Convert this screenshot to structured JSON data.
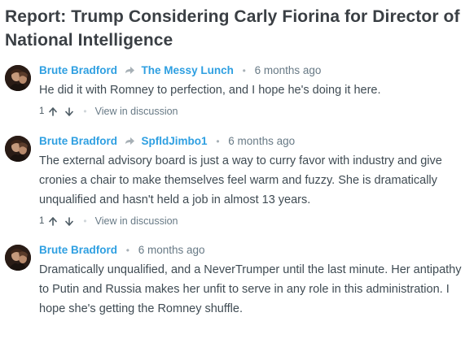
{
  "headline": "Report: Trump Considering Carly Fiorina for Director of National Intelligence",
  "colors": {
    "link": "#2e9fe1",
    "text": "#3f4b53",
    "muted": "#687a86",
    "headline": "#3a3f44"
  },
  "icons": {
    "reply_arrow": "reply-arrow-icon",
    "upvote": "upvote-arrow-icon",
    "downvote": "downvote-arrow-icon"
  },
  "comments": [
    {
      "author": "Brute Bradford",
      "reply_to": "The Messy Lunch",
      "time": "6 months ago",
      "body": "He did it with Romney to perfection, and I hope he's doing it here.",
      "votes": "1",
      "view_link": "View in discussion"
    },
    {
      "author": "Brute Bradford",
      "reply_to": "SpfldJimbo1",
      "time": "6 months ago",
      "body": "The external advisory board is just a way to curry favor with industry and give cronies a chair to make themselves feel warm and fuzzy. She is dramatically unqualified and hasn't held a job in almost 13 years.",
      "votes": "1",
      "view_link": "View in discussion"
    },
    {
      "author": "Brute Bradford",
      "time": "6 months ago",
      "body": "Dramatically unqualified, and a NeverTrumper until the last minute. Her antipathy to Putin and Russia makes her unfit to serve in any role in this administration. I hope she's getting the Romney shuffle."
    }
  ]
}
